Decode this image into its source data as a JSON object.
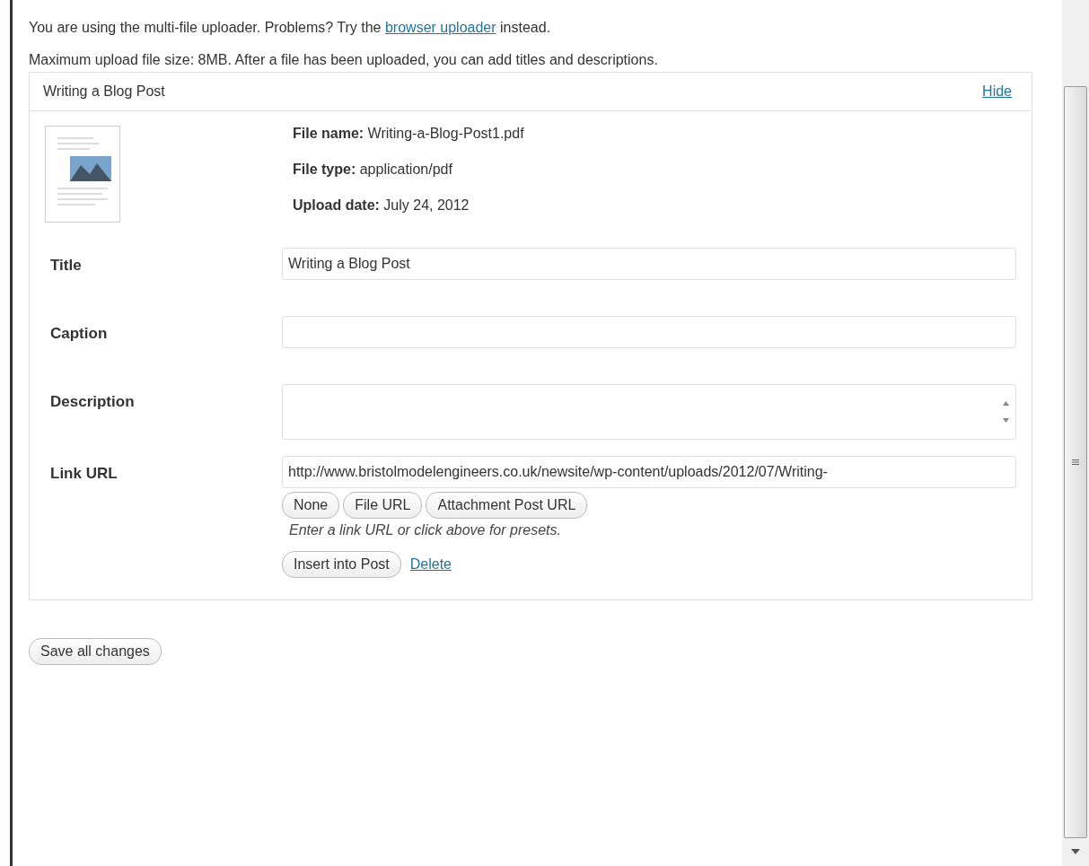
{
  "notice": {
    "before": "You are using the multi-file uploader. Problems? Try the",
    "link": "browser uploader",
    "after": "instead."
  },
  "limits": "Maximum upload file size: 8MB. After a file has been uploaded, you can add titles and descriptions.",
  "item": {
    "title": "Writing a Blog Post",
    "toggle": "Hide",
    "meta": [
      {
        "label": "File name:",
        "value": "Writing-a-Blog-Post1.pdf"
      },
      {
        "label": "File type:",
        "value": "application/pdf"
      },
      {
        "label": "Upload date:",
        "value": "July 24, 2012"
      }
    ],
    "fields": [
      {
        "label": "Title",
        "kind": "text",
        "value": "Writing a Blog Post"
      },
      {
        "label": "Caption",
        "kind": "text"
      },
      {
        "label": "Description",
        "kind": "textarea"
      },
      {
        "label": "Link URL",
        "kind": "url",
        "value": "http://www.bristolmodelengineers.co.uk/newsite/wp-content/uploads/2012/07/Writing-",
        "presets": [
          "None",
          "File URL",
          "Attachment Post URL"
        ],
        "help": "Enter a link URL or click above for presets."
      }
    ],
    "insert_button": "Insert into Post",
    "delete_link": "Delete"
  },
  "save_button": "Save all changes"
}
